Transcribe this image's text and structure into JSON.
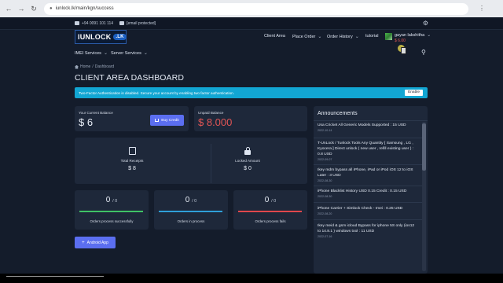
{
  "browser": {
    "url": "iunlock.lk/main/kgn/success"
  },
  "topbar": {
    "phone": "+94 0091 101 114",
    "email": "[email protected]"
  },
  "header": {
    "logo_text": "IUNLOCK",
    "logo_badge": ".LK",
    "nav": [
      "Client Area",
      "Place Order",
      "Order History",
      "tutorial"
    ],
    "user_name": "gayan lakshitha",
    "user_balance": "$ 6.00",
    "subnav": [
      "IMEI Services",
      "Server Services"
    ]
  },
  "breadcrumb": {
    "home": "Home",
    "current": "Dashboard"
  },
  "page_title": "CLIENT AREA DASHBOARD",
  "alert": {
    "text": "Two-Factor Authentication is disabled. Secure your account by enabling two factor authentication.",
    "button": "Enable"
  },
  "balance": {
    "current_label": "Your Current Balance",
    "current_value": "$ 6",
    "buy_label": "Buy Credit",
    "unpaid_label": "Unpaid Balance",
    "unpaid_value": "$ 8.000"
  },
  "stats": {
    "receipts_label": "Total Receipts",
    "receipts_value": "$ 8",
    "locked_label": "Locked Amount",
    "locked_value": "$ 0"
  },
  "orders": [
    {
      "count": "0",
      "total": "/ 0",
      "label": "Orders process successfully",
      "color": "#3fc266"
    },
    {
      "count": "0",
      "total": "/ 0",
      "label": "Orders in process",
      "color": "#2f9fd8"
    },
    {
      "count": "0",
      "total": "/ 0",
      "label": "Orders process fails",
      "color": "#e0474c"
    }
  ],
  "android_button": "Android App",
  "announcements": {
    "title": "Announcements",
    "items": [
      {
        "text": "Usa Cricket All Generic Models Supported : 15 USD",
        "date": "2022-10-14"
      },
      {
        "text": "T-UnLock / Tunlock Tools Any Quantity [ Samsung , LG , Kyocera ] Direct unlock ( new user , refill existing user ) : 0.8 USD",
        "date": "2022-09-07"
      },
      {
        "text": "Ikey mdm bypass all iPhone, iPad or iPod iOS 12 to iOS Later : 3 USD",
        "date": "2022-08-30"
      },
      {
        "text": "iPhone Blacklist History USD 0.15 Credit : 0.15 USD",
        "date": "2022-08-30"
      },
      {
        "text": "iPhone Carrier + Simlock Check - Imei : 0.25 USD",
        "date": "2022-08-20"
      },
      {
        "text": "Ikey meid & gsm icloud Bypass for iphone 5S only (ios12 to 14.8.1 ) windows tool : 11 USD",
        "date": "2022-07-16"
      }
    ]
  },
  "colors": {
    "accent": "#5b6ef0",
    "alert": "#12a6d3",
    "unpaid": "#e25555"
  }
}
